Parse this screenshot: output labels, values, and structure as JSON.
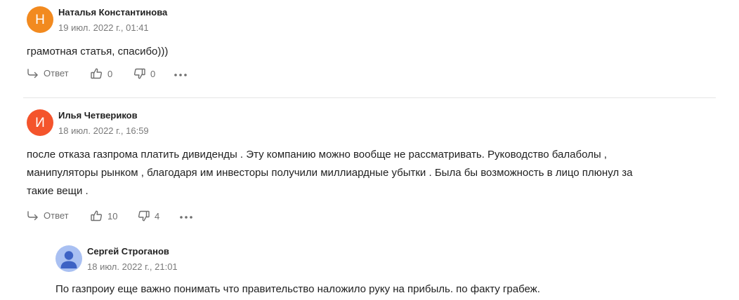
{
  "comments": [
    {
      "author": "Наталья Константинова",
      "avatar_letter": "Н",
      "avatar_color": "#f28a1f",
      "date": "19 июл. 2022 г., 01:41",
      "text_lines": [
        "грамотная статья, спасибо)))"
      ],
      "reply_label": "Ответ",
      "likes": "0",
      "dislikes": "0"
    },
    {
      "author": "Илья Четвериков",
      "avatar_letter": "И",
      "avatar_color": "#f4542c",
      "date": "18 июл. 2022 г., 16:59",
      "text_lines": [
        "после отказа газпрома платить дивиденды . Эту компанию можно вообще не рассматривать. Руководство балаболы ,",
        "манипуляторы рынком , благодаря им инвесторы получили миллиардные убытки . Была бы возможность в лицо плюнул за",
        "такие вещи ."
      ],
      "reply_label": "Ответ",
      "likes": "10",
      "dislikes": "4"
    }
  ],
  "reply": {
    "author": "Сергей Строганов",
    "avatar_color": "#a9c0f2",
    "date": "18 июл. 2022 г., 21:01",
    "text_lines": [
      "По газпроиу еще важно понимать что правительство наложило руку на прибыль. по факту грабеж."
    ]
  }
}
